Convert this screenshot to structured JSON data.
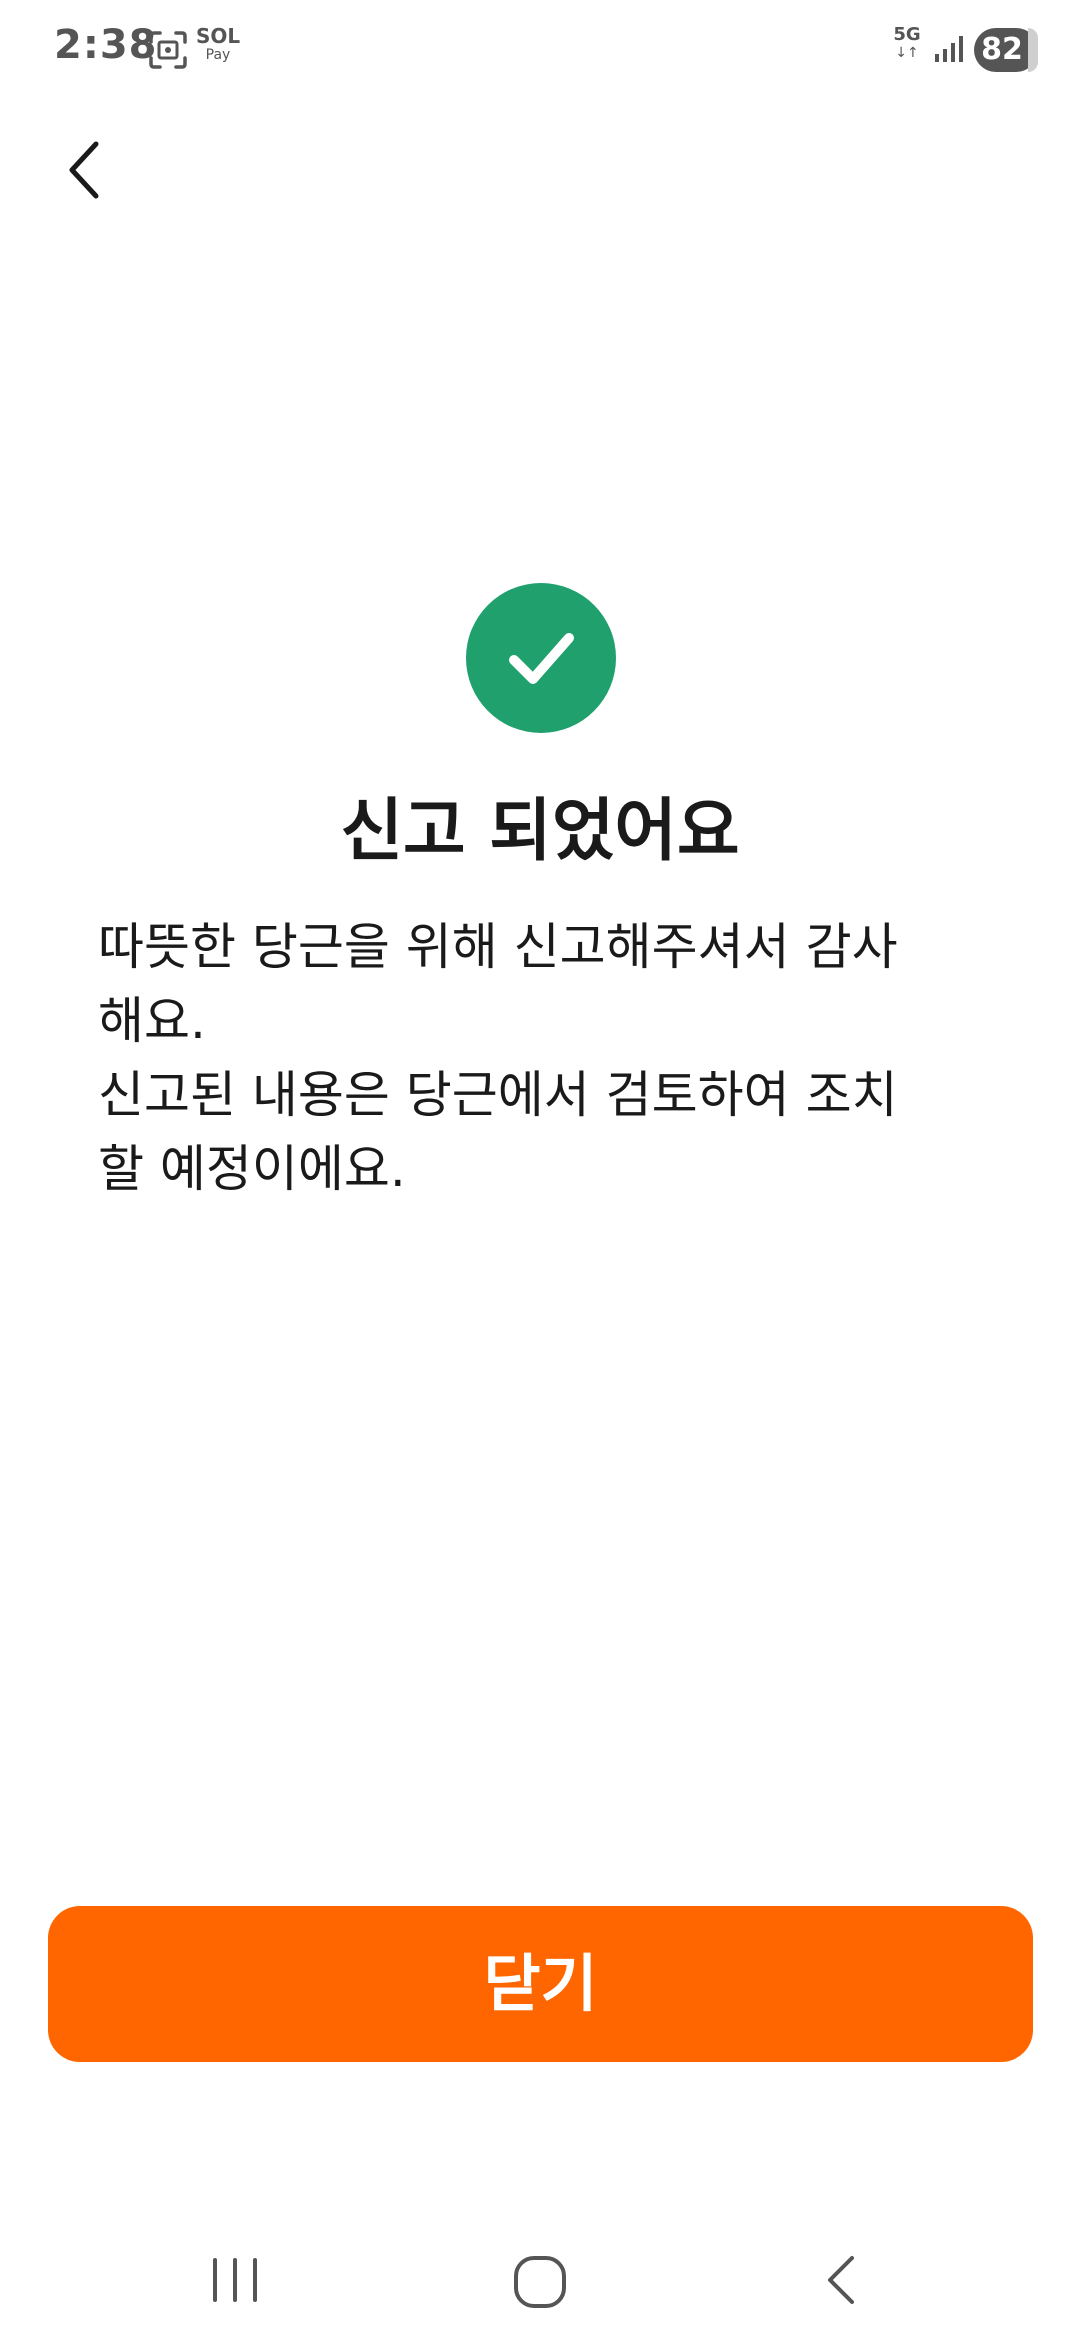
{
  "status_bar": {
    "time": "2:38",
    "sol_top": "SOL",
    "sol_bottom": "Pay",
    "network": "5G",
    "network_arrows": "↓↑",
    "battery": "82"
  },
  "icons": {
    "back": "chevron-left-icon",
    "success": "check-circle-icon",
    "screenshot": "screenshot-icon",
    "signal": "signal-icon",
    "nav_recents": "recents-icon",
    "nav_home": "home-icon",
    "nav_back": "back-icon"
  },
  "content": {
    "title": "신고 되었어요",
    "message": "따뜻한 당근을 위해 신고해주셔서 감사\n해요.\n신고된 내용은 당근에서 검토하여 조치\n할 예정이에요."
  },
  "actions": {
    "close_label": "닫기"
  },
  "colors": {
    "accent": "#ff6600",
    "success": "#1fa06c",
    "text": "#1a1a1a",
    "status_text": "#555555"
  }
}
